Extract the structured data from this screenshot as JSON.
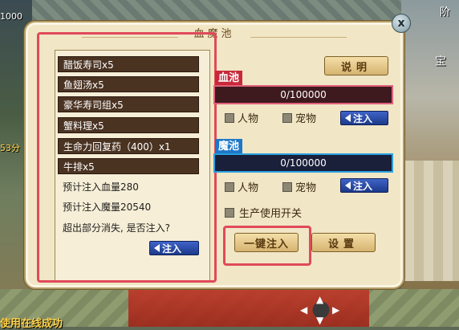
{
  "hud": {
    "top_left_value": "1000",
    "score": "53分",
    "status": "使用在线成功",
    "right_top": "阶",
    "right_mid": "宝"
  },
  "dialog": {
    "title": "血魔池",
    "close_label": "x",
    "items": [
      "醋饭寿司x5",
      "鱼翅汤x5",
      "豪华寿司组x5",
      "蟹料理x5",
      "生命力回复药（400）x1",
      "牛排x5"
    ],
    "estimate_blood": "预计注入血量280",
    "estimate_magic": "预计注入魔量20540",
    "overflow_prompt": "超出部分消失, 是否注入?",
    "inject_label": "注入",
    "help_label": "说明",
    "blood_pool": {
      "label": "血池",
      "value": "0/100000",
      "opt_character": "人物",
      "opt_pet": "宠物",
      "inject_label": "注入"
    },
    "magic_pool": {
      "label": "魔池",
      "value": "0/100000",
      "opt_character": "人物",
      "opt_pet": "宠物",
      "inject_label": "注入"
    },
    "production_switch": "生产使用开关",
    "one_click_inject": "一键注入",
    "settings_label": "设置"
  },
  "colors": {
    "blood_label_bg": "#c8283a",
    "magic_label_bg": "#1e78c8",
    "blood_border": "#e0607a",
    "magic_border": "#2aa0e0",
    "highlight": "#e04a5a",
    "item_bg": "#4b3322"
  }
}
